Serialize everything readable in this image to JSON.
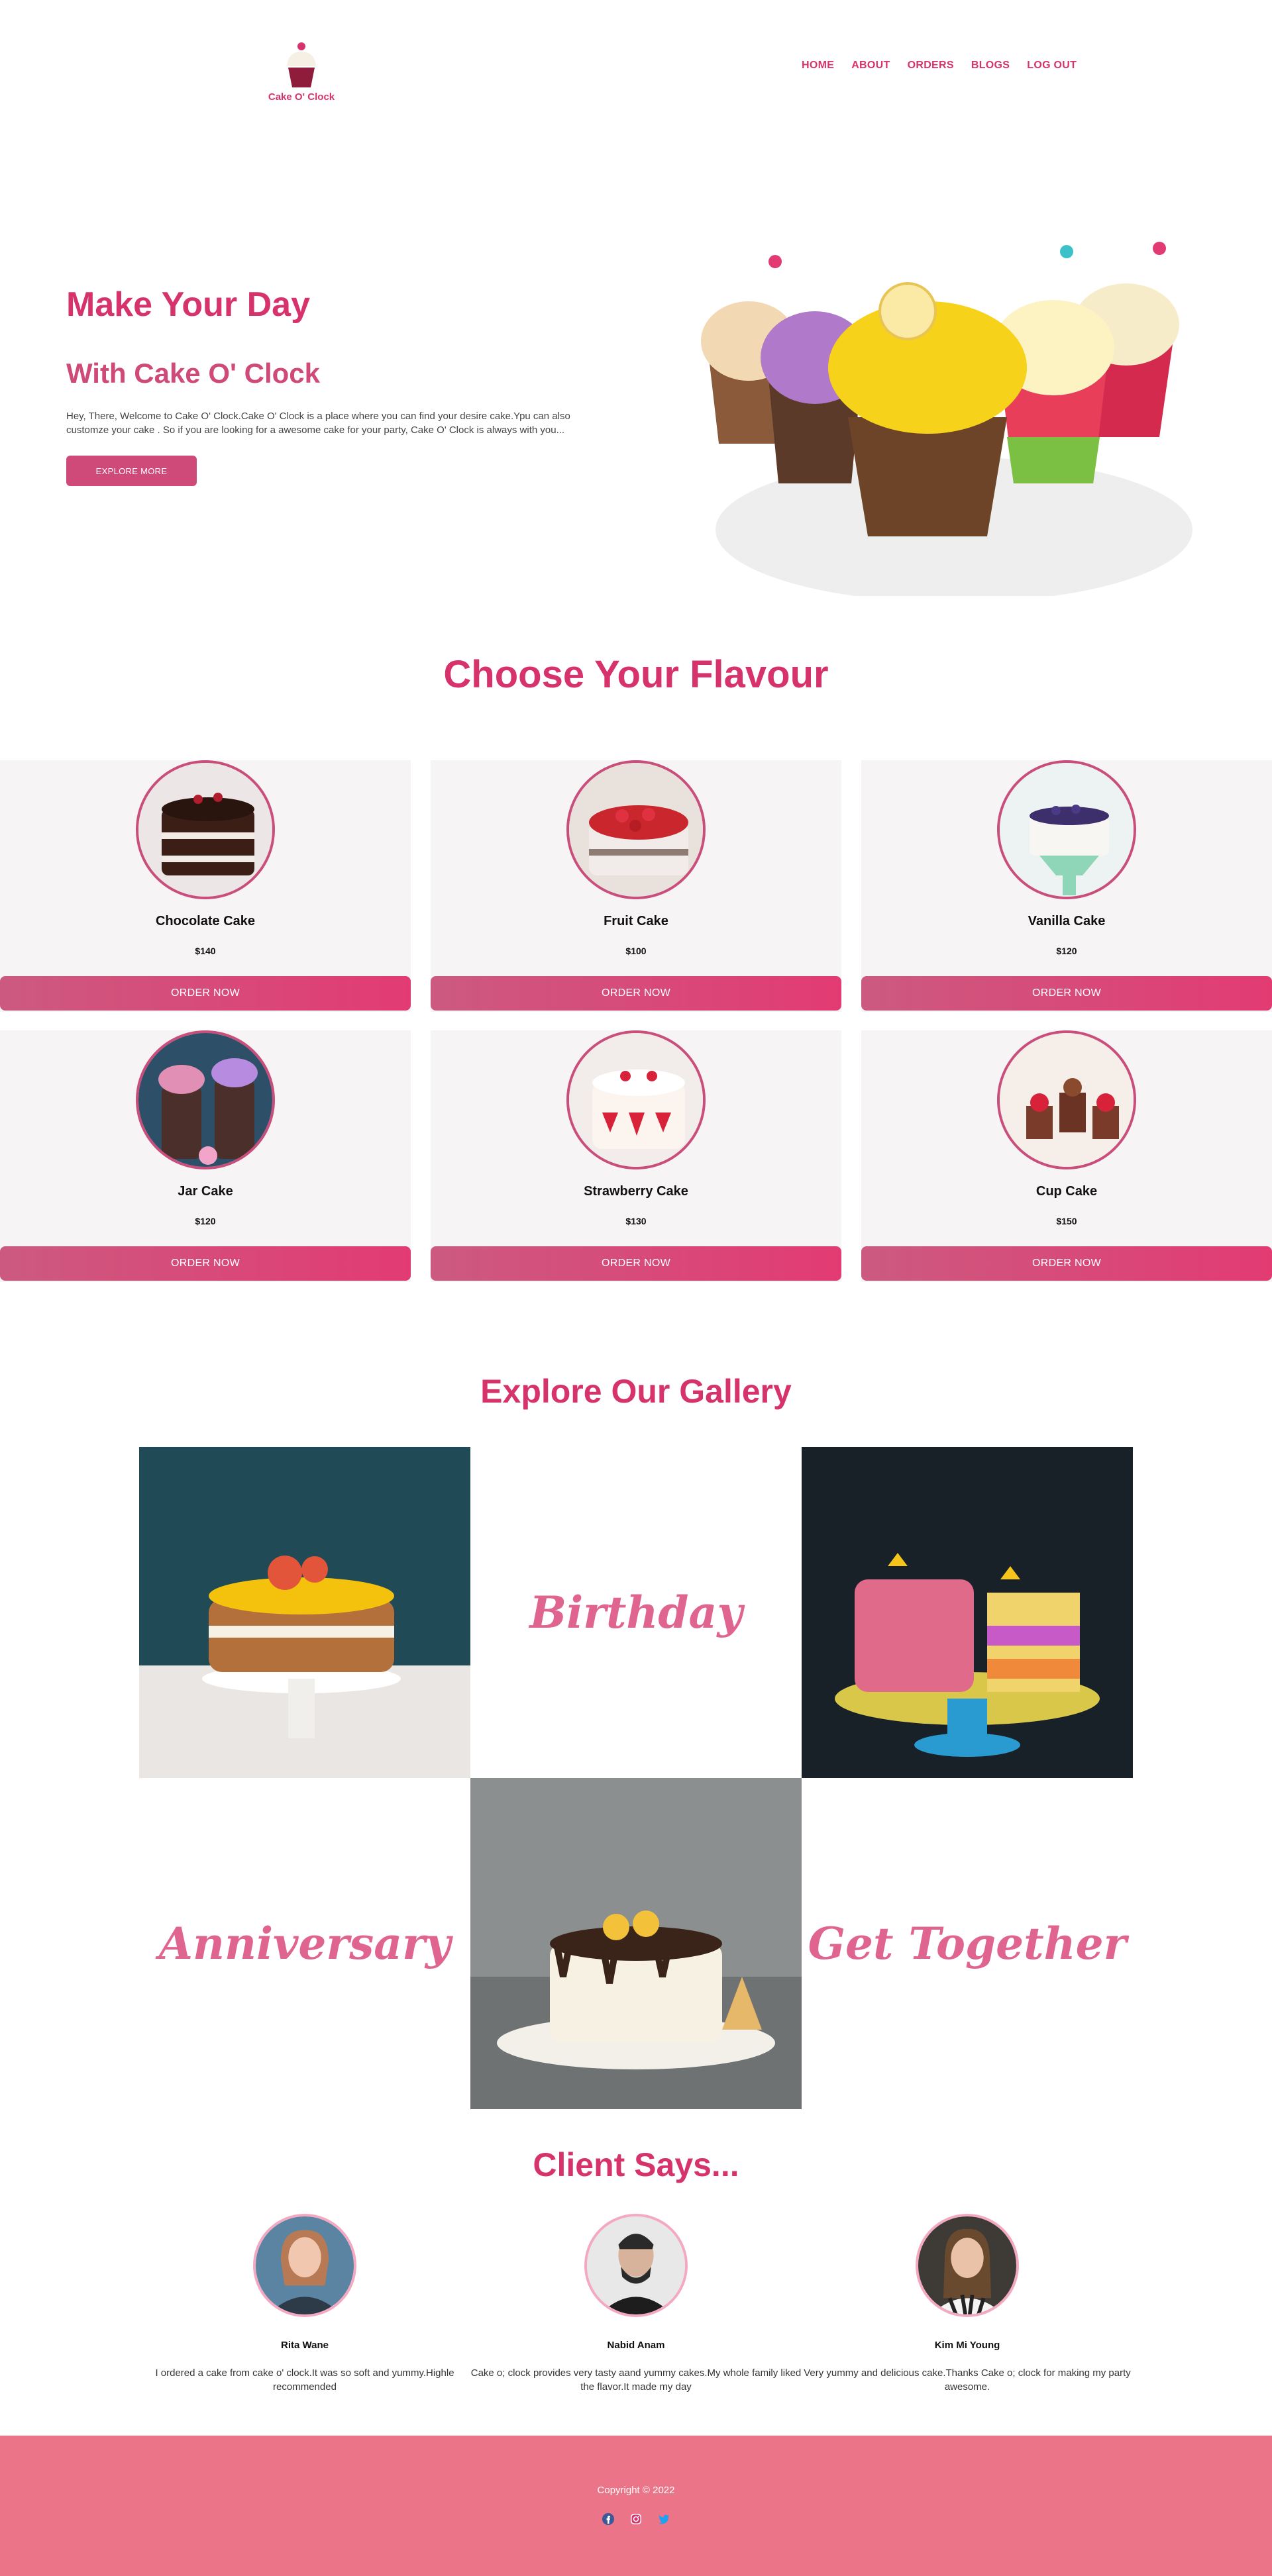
{
  "nav": {
    "logo_text": "Cake O' Clock",
    "links": [
      "HOME",
      "ABOUT",
      "ORDERS",
      "BLOGS",
      "LOG OUT"
    ]
  },
  "hero": {
    "title": "Make Your Day",
    "subtitle": "With Cake O' Clock",
    "text": "Hey, There, Welcome to Cake O' Clock.Cake O' Clock is a place where you can find your desire cake.Ypu can also customze your cake . So if you are looking for a awesome cake for your party, Cake O' Clock is always with you...",
    "button": "EXPLORE MORE"
  },
  "flavour": {
    "title": "Choose Your Flavour",
    "order_label": "ORDER NOW",
    "cards": [
      {
        "name": "Chocolate Cake",
        "price": "$140"
      },
      {
        "name": "Fruit Cake",
        "price": "$100"
      },
      {
        "name": "Vanilla Cake",
        "price": "$120"
      },
      {
        "name": "Jar Cake",
        "price": "$120"
      },
      {
        "name": "Strawberry Cake",
        "price": "$130"
      },
      {
        "name": "Cup Cake",
        "price": "$150"
      }
    ]
  },
  "gallery": {
    "title": "Explore Our Gallery",
    "words": [
      "Birthday",
      "Anniversary",
      "Get Together"
    ]
  },
  "clients": {
    "title": "Client Says...",
    "items": [
      {
        "name": "Rita Wane",
        "text": "I ordered a cake from cake o' clock.It was so soft and yummy.Highle recommended"
      },
      {
        "name": "Nabid Anam",
        "text": "Cake o; clock provides very tasty aand yummy cakes.My whole family liked the flavor.It made my day"
      },
      {
        "name": "Kim Mi Young",
        "text": "Very yummy and delicious cake.Thanks Cake o; clock for making my party awesome."
      }
    ]
  },
  "footer": {
    "copyright": "Copyright © 2022",
    "social": [
      "facebook-icon",
      "instagram-icon",
      "twitter-icon"
    ]
  },
  "colors": {
    "brand": "#d6336c",
    "footer": "#ec7489"
  }
}
